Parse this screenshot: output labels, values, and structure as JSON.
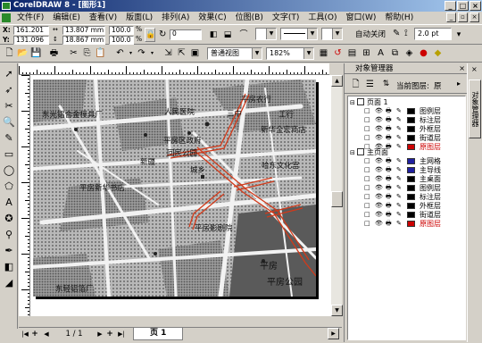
{
  "window": {
    "title": "CorelDRAW 8 - [图形1]"
  },
  "menu": [
    "文件(F)",
    "编辑(E)",
    "查看(V)",
    "版面(L)",
    "排列(A)",
    "效果(C)",
    "位图(B)",
    "文字(T)",
    "工具(O)",
    "窗口(W)",
    "帮助(H)"
  ],
  "propbar": {
    "x_label": "X:",
    "x_value": "161.201",
    "y_label": "Y:",
    "y_value": "131.096",
    "w_value": "13.807 mm",
    "h_value": "18.867 mm",
    "scale_x": "100.0",
    "scale_y": "100.0",
    "pct": "%",
    "rotation": "0",
    "auto_close": "自动关闭",
    "outline_width": "2.0 pt"
  },
  "stdbar": {
    "view_mode": "普通视图",
    "zoom": "182%"
  },
  "pagenav": {
    "page_count": "1 / 1",
    "page_tab": "页 1"
  },
  "docker": {
    "title": "对象管理器",
    "current_layer_label": "当前图层:",
    "current_layer": "原",
    "vertical_tab": "对象管理器",
    "page1_label": "页面 1",
    "page1_layers": [
      {
        "name": "图例层",
        "color": "#000000"
      },
      {
        "name": "标注层",
        "color": "#000000"
      },
      {
        "name": "外框层",
        "color": "#000000"
      },
      {
        "name": "街道层",
        "color": "#000000"
      },
      {
        "name": "原图层",
        "color": "#cc0000"
      }
    ],
    "master_label": "主页面",
    "master_layers": [
      {
        "name": "主网格",
        "color": "#2020a0"
      },
      {
        "name": "主导线",
        "color": "#2020a0"
      },
      {
        "name": "主桌面",
        "color": "#000000"
      },
      {
        "name": "图例层",
        "color": "#000000"
      },
      {
        "name": "标注层",
        "color": "#000000"
      },
      {
        "name": "外框层",
        "color": "#000000"
      },
      {
        "name": "街道层",
        "color": "#000000"
      },
      {
        "name": "原图层",
        "color": "#cc0000"
      }
    ]
  },
  "map_labels": [
    {
      "text": "平房农行",
      "id": "label-nongxing"
    },
    {
      "text": "人民医院",
      "id": "label-hospital"
    },
    {
      "text": "工行",
      "id": "label-gonghang"
    },
    {
      "text": "三中",
      "id": "label-sanzhong"
    },
    {
      "text": "新华全宏商店",
      "id": "label-store"
    },
    {
      "text": "东光铝合金模具厂",
      "id": "label-factory"
    },
    {
      "text": "平房区政府",
      "id": "label-gov"
    },
    {
      "text": "回民公园",
      "id": "label-park"
    },
    {
      "text": "城乡",
      "id": "label-chengxiang"
    },
    {
      "text": "新疆",
      "id": "label-xinjiang"
    },
    {
      "text": "哈东文化宫",
      "id": "label-culture"
    },
    {
      "text": "平房影剧院",
      "id": "label-cinema"
    },
    {
      "text": "平房新华书店",
      "id": "label-bookstore"
    },
    {
      "text": "平房",
      "id": "label-pingfang"
    },
    {
      "text": "平房公园",
      "id": "label-park2"
    },
    {
      "text": "东轻铝箔厂",
      "id": "label-foil"
    }
  ],
  "colors": {
    "title_start": "#0a246a",
    "title_end": "#a6caf0",
    "street_highlight": "#d23a1a"
  }
}
